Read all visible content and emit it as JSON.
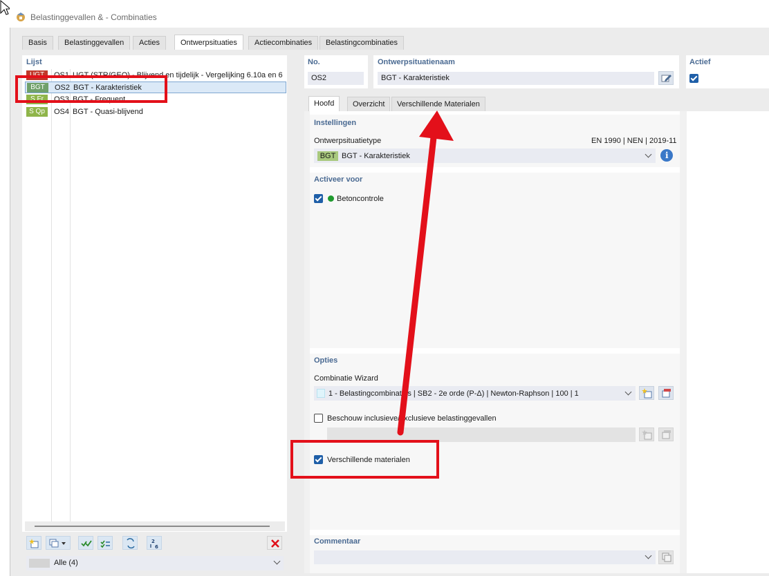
{
  "window": {
    "title": "Belastinggevallen & - Combinaties"
  },
  "main_tabs": [
    "Basis",
    "Belastinggevallen",
    "Acties",
    "Ontwerpsituaties",
    "Actiecombinaties",
    "Belastingcombinaties"
  ],
  "list": {
    "title": "Lijst",
    "rows": [
      {
        "badge": "UGT",
        "badge_color": "#c0392b",
        "badge_text_color": "#ffffff",
        "no": "OS1",
        "name": "UGT (STR/GEO) - Blijvend en tijdelijk - Vergelijking 6.10a en 6"
      },
      {
        "badge": "BGT",
        "badge_color": "#6fa06a",
        "badge_text_color": "#ffffff",
        "no": "OS2",
        "name": "BGT - Karakteristiek"
      },
      {
        "badge": "S Fr",
        "badge_color": "#8fb54a",
        "badge_text_color": "#ffffff",
        "no": "OS3",
        "name": "BGT - Frequent"
      },
      {
        "badge": "S Qp",
        "badge_color": "#8fb54a",
        "badge_text_color": "#ffffff",
        "no": "OS4",
        "name": "BGT - Quasi-blijvend"
      }
    ],
    "filter_value": "Alle (4)"
  },
  "header_fields": {
    "no_label": "No.",
    "no_value": "OS2",
    "name_label": "Ontwerpsituatienaam",
    "name_value": "BGT - Karakteristiek",
    "active_label": "Actief"
  },
  "sub_tabs": [
    "Hoofd",
    "Overzicht",
    "Verschillende Materialen"
  ],
  "instellingen": {
    "title": "Instellingen",
    "type_label": "Ontwerpsituatietype",
    "standard": "EN 1990 | NEN | 2019-11",
    "type_badge": "BGT",
    "type_value": "BGT - Karakteristiek"
  },
  "activeer": {
    "title": "Activeer voor",
    "item": "Betoncontrole"
  },
  "opties": {
    "title": "Opties",
    "wizard_label": "Combinatie Wizard",
    "wizard_value": "1 - Belastingcombinaties | SB2 - 2e orde (P-Δ) | Newton-Raphson | 100 | 1",
    "inclusive_label": "Beschouw inclusieve/exclusieve belastinggevallen",
    "materials_label": "Verschillende materialen"
  },
  "commentaar": {
    "title": "Commentaar"
  },
  "colors": {
    "accent": "#1f5fa8",
    "annotation_red": "#e3101a",
    "section_title": "#4a6a92"
  }
}
